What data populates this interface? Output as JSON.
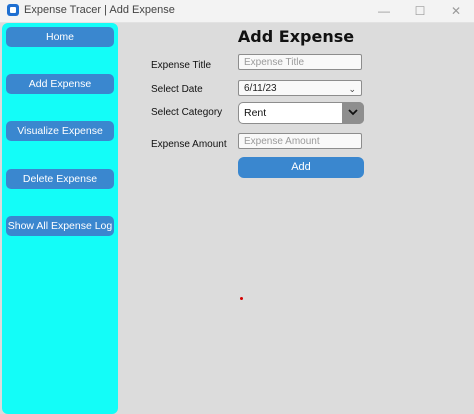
{
  "window": {
    "title": "Expense Tracer | Add Expense",
    "controls": {
      "minimize": "—",
      "maximize": "☐",
      "close": "✕"
    }
  },
  "sidebar": {
    "background": "#13fdf8",
    "items": [
      {
        "label": "Home"
      },
      {
        "label": "Add Expense"
      },
      {
        "label": "Visualize Expense"
      },
      {
        "label": "Delete Expense"
      },
      {
        "label": "Show All Expense Log"
      }
    ]
  },
  "form": {
    "heading": "Add Expense",
    "title_label": "Expense Title",
    "title_placeholder": "Expense Title",
    "date_label": "Select Date",
    "date_value": "6/11/23",
    "category_label": "Select Category",
    "category_value": "Rent",
    "amount_label": "Expense Amount",
    "amount_placeholder": "Expense Amount",
    "submit_label": "Add"
  },
  "colors": {
    "accent": "#3a87cf",
    "background": "#dcdcdc",
    "dot": "#d40000"
  }
}
